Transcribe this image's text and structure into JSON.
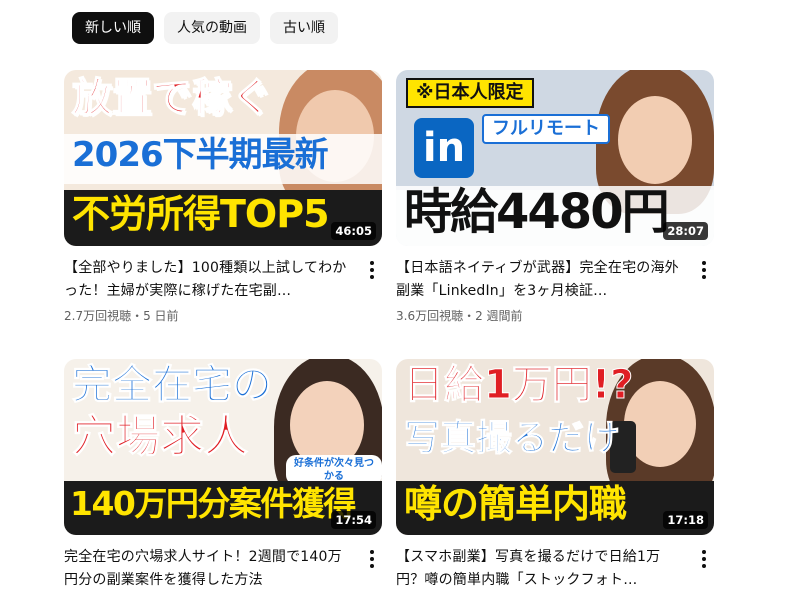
{
  "filters": {
    "newest": "新しい順",
    "popular": "人気の動画",
    "oldest": "古い順"
  },
  "videos": [
    {
      "title": "【全部やりました】100種類以上試してわかった！主婦が実際に稼げた在宅副…",
      "stats": "2.7万回視聴・5 日前",
      "duration": "46:05",
      "thumb": {
        "line1": "放置で稼ぐ",
        "line2": "2026下半期最新",
        "line3": "不労所得TOP5"
      }
    },
    {
      "title": "【日本語ネイティブが武器】完全在宅の海外副業「LinkedIn」を3ヶ月検証…",
      "stats": "3.6万回視聴・2 週間前",
      "duration": "28:07",
      "thumb": {
        "badge": "※日本人限定",
        "logo": "in",
        "tag": "フルリモート",
        "wage": "時給4480円"
      }
    },
    {
      "title": "完全在宅の穴場求人サイト！2週間で140万円分の副業案件を獲得した方法",
      "stats": "",
      "duration": "17:54",
      "thumb": {
        "line1": "完全在宅の",
        "line2": "穴場求人",
        "bubble": "好条件が次々見つかる",
        "line3": "140万円分案件獲得"
      }
    },
    {
      "title": "【スマホ副業】写真を撮るだけで日給1万円？噂の簡単内職「ストックフォト…",
      "stats": "",
      "duration": "17:18",
      "thumb": {
        "line1": "日給1万円!?",
        "line2": "写真撮るだけ",
        "line3": "噂の簡単内職"
      }
    }
  ],
  "colors": {
    "chip_active_bg": "#0f0f0f",
    "chip_bg": "#f2f2f2",
    "text_primary": "#0f0f0f",
    "text_secondary": "#606060",
    "thumb_red": "#e01e24",
    "thumb_blue": "#1a6fd6",
    "thumb_yellow": "#ffe400",
    "linkedin_blue": "#0a66c2"
  },
  "icons": {
    "more": "more-vert-icon",
    "linkedin": "linkedin-logo-icon"
  }
}
